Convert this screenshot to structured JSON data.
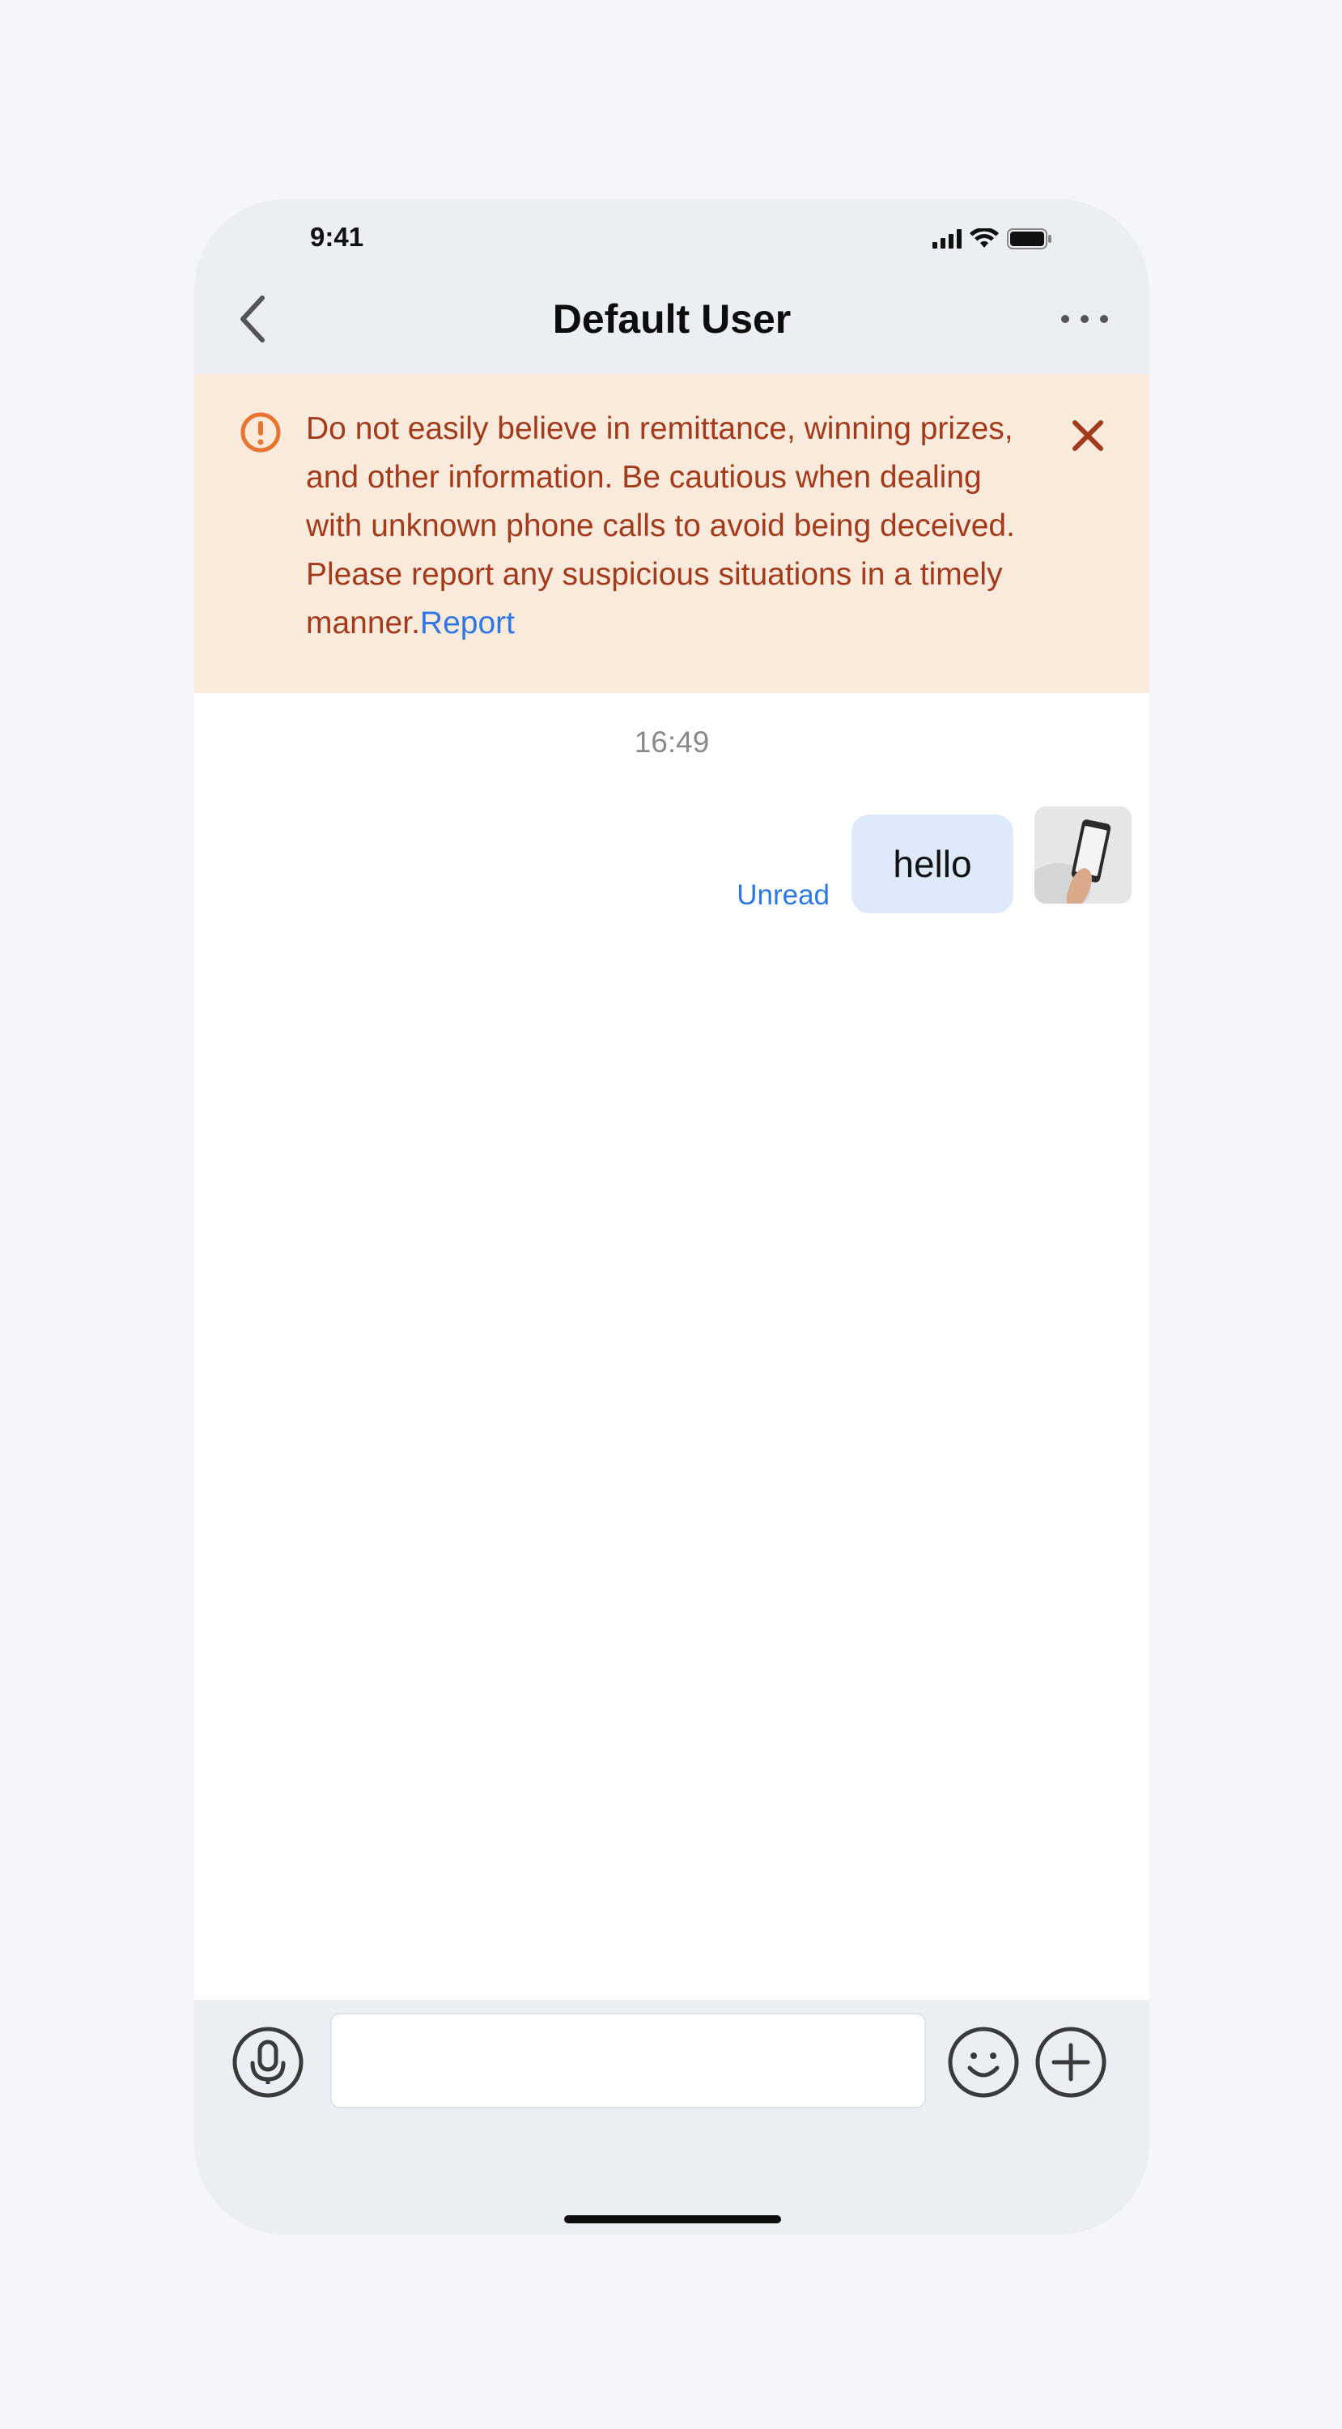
{
  "status_bar": {
    "time": "9:41"
  },
  "nav": {
    "title": "Default User",
    "back_icon": "chevron-left-icon",
    "more_icon": "ellipsis-icon"
  },
  "warning": {
    "text": "Do not easily believe in remittance, winning prizes, and other information. Be cautious when dealing with unknown phone calls to avoid being deceived. Please report any suspicious situations in a timely manner.",
    "link_label": "Report",
    "icon": "alert-circle-icon",
    "close_icon": "close-icon",
    "text_color": "#a23a1b",
    "background": "#faeadb"
  },
  "chat": {
    "timestamp": "16:49",
    "messages": [
      {
        "text": "hello",
        "status": "Unread",
        "sender": "self"
      }
    ]
  },
  "composer": {
    "placeholder": "",
    "voice_icon": "microphone-icon",
    "emoji_icon": "smiley-icon",
    "plus_icon": "plus-circle-icon"
  },
  "colors": {
    "accent": "#2f77e3",
    "bubble_self": "#dee9f9",
    "chrome": "#ebeff4",
    "page_background": "#f4f6fa"
  }
}
